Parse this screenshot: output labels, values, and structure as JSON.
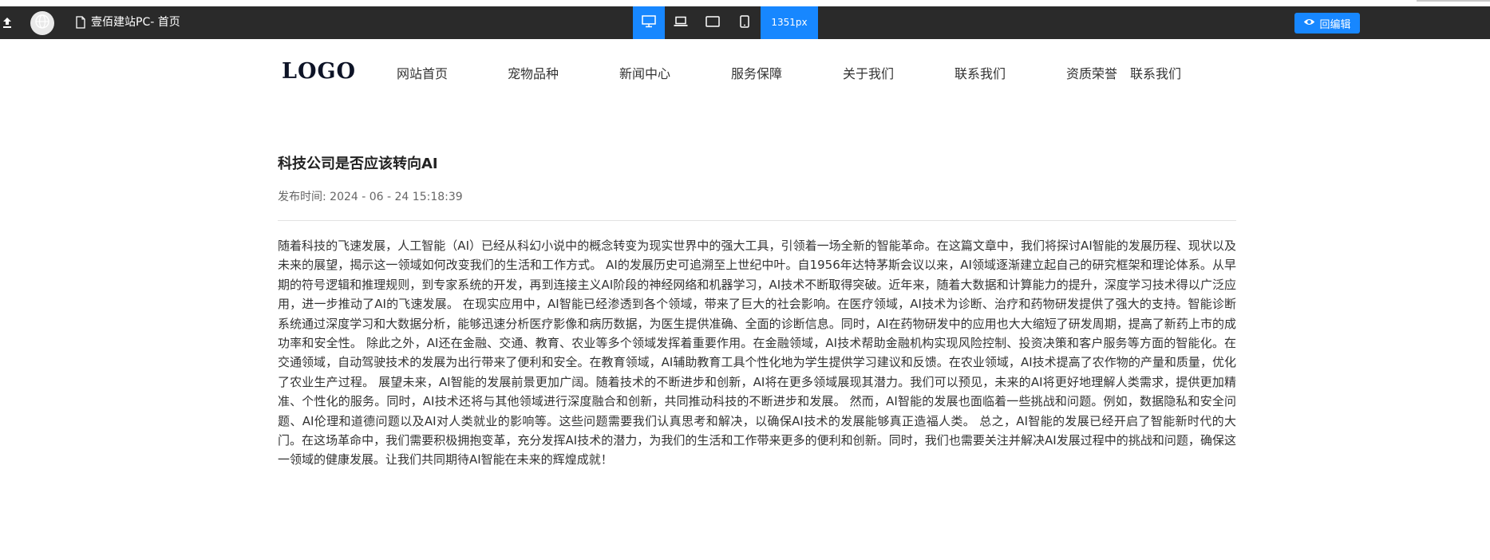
{
  "editor": {
    "page_name": "壹佰建站PC- 首页",
    "width_label": "1351px",
    "back_edit_label": "回编辑",
    "devices": [
      "desktop",
      "laptop",
      "tablet",
      "mobile"
    ],
    "accent_color": "#1787ff",
    "bar_color": "#2a2a2a"
  },
  "site": {
    "logo": "LOGO",
    "nav": [
      "网站首页",
      "宠物品种",
      "新闻中心",
      "服务保障",
      "关于我们",
      "联系我们",
      "资质荣誉",
      "联系我们"
    ]
  },
  "article": {
    "title": "科技公司是否应该转向AI",
    "published_label": "发布时间:",
    "published": "2024 - 06 - 24 15:18:39",
    "body": "随着科技的飞速发展，人工智能（AI）已经从科幻小说中的概念转变为现实世界中的强大工具，引领着一场全新的智能革命。在这篇文章中，我们将探讨AI智能的发展历程、现状以及未来的展望，揭示这一领域如何改变我们的生活和工作方式。 AI的发展历史可追溯至上世纪中叶。自1956年达特茅斯会议以来，AI领域逐渐建立起自己的研究框架和理论体系。从早期的符号逻辑和推理规则，到专家系统的开发，再到连接主义AI阶段的神经网络和机器学习，AI技术不断取得突破。近年来，随着大数据和计算能力的提升，深度学习技术得以广泛应用，进一步推动了AI的飞速发展。 在现实应用中，AI智能已经渗透到各个领域，带来了巨大的社会影响。在医疗领域，AI技术为诊断、治疗和药物研发提供了强大的支持。智能诊断系统通过深度学习和大数据分析，能够迅速分析医疗影像和病历数据，为医生提供准确、全面的诊断信息。同时，AI在药物研发中的应用也大大缩短了研发周期，提高了新药上市的成功率和安全性。 除此之外，AI还在金融、交通、教育、农业等多个领域发挥着重要作用。在金融领域，AI技术帮助金融机构实现风险控制、投资决策和客户服务等方面的智能化。在交通领域，自动驾驶技术的发展为出行带来了便利和安全。在教育领域，AI辅助教育工具个性化地为学生提供学习建议和反馈。在农业领域，AI技术提高了农作物的产量和质量，优化了农业生产过程。 展望未来，AI智能的发展前景更加广阔。随着技术的不断进步和创新，AI将在更多领域展现其潜力。我们可以预见，未来的AI将更好地理解人类需求，提供更加精准、个性化的服务。同时，AI技术还将与其他领域进行深度融合和创新，共同推动科技的不断进步和发展。 然而，AI智能的发展也面临着一些挑战和问题。例如，数据隐私和安全问题、AI伦理和道德问题以及AI对人类就业的影响等。这些问题需要我们认真思考和解决，以确保AI技术的发展能够真正造福人类。 总之，AI智能的发展已经开启了智能新时代的大门。在这场革命中，我们需要积极拥抱变革，充分发挥AI技术的潜力，为我们的生活和工作带来更多的便利和创新。同时，我们也需要关注并解决AI发展过程中的挑战和问题，确保这一领域的健康发展。让我们共同期待AI智能在未来的辉煌成就！"
  }
}
